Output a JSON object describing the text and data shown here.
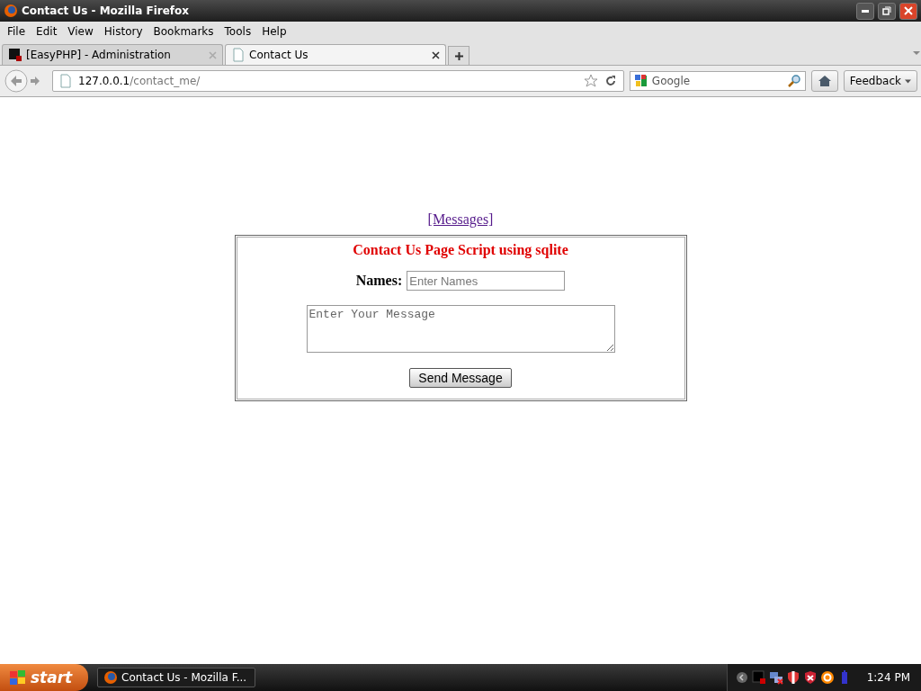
{
  "window": {
    "title": "Contact Us - Mozilla Firefox"
  },
  "menu": [
    "File",
    "Edit",
    "View",
    "History",
    "Bookmarks",
    "Tools",
    "Help"
  ],
  "tabs": [
    {
      "label": "[EasyPHP] - Administration",
      "selected": false,
      "kind": "easyphp"
    },
    {
      "label": "Contact Us",
      "selected": true,
      "kind": "page"
    }
  ],
  "address_bar": {
    "host": "127.0.0.1",
    "path": "/contact_me/"
  },
  "search": {
    "placeholder": "Google"
  },
  "feedback_button": "Feedback",
  "page": {
    "link": "[Messages]",
    "form_title": "Contact Us Page Script using sqlite",
    "names_label": "Names:",
    "names_placeholder": "Enter Names",
    "message_placeholder": "Enter Your Message",
    "submit": "Send Message"
  },
  "taskbar": {
    "start": "start",
    "window_button": "Contact Us - Mozilla F...",
    "clock": "1:24 PM"
  }
}
